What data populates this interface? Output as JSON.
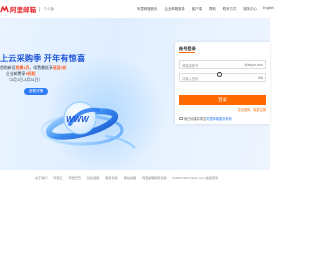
{
  "header": {
    "logo_text": "阿里邮箱",
    "logo_sub": "个人版",
    "nav": [
      {
        "label": "阿里邮箱首页"
      },
      {
        "label": "企业邮箱登录"
      },
      {
        "label": "客户端"
      },
      {
        "label": "帮助"
      },
      {
        "label": "联系方式"
      },
      {
        "label": "服务中心"
      },
      {
        "label": "English"
      }
    ]
  },
  "banner": {
    "title": "上云采购季 开年有惊喜",
    "line1_a": "首购新设",
    "line1_hl": "免费1月",
    "line1_b": "，续费最低享",
    "line1_hl2": "低至5折",
    "line2_a": "企业",
    "line2_b": "邮费享",
    "line2_hl": "9折起",
    "line3": "（3月1日-3月31日）",
    "button": "查看详情",
    "art_text": "WWW"
  },
  "login": {
    "title": "账号登录",
    "account_placeholder": "邮箱或账号",
    "account_suffix": "@aliyun.com",
    "password_placeholder": "请输入密码",
    "submit": "登录",
    "link_forgot": "忘记密码",
    "link_register": "免费注册",
    "agree_text": "我已阅读并同意",
    "agree_link": "阿里邮箱服务条款"
  },
  "footer": {
    "links": [
      "关于我们",
      "阿里云",
      "阿里巴巴",
      "隐私政策",
      "服务条款",
      "网站地图",
      "阿里邮箱服务条款",
      "©2009-2023 Aliyun.com 版权所有",
      "ICP证：浙B2-20080101"
    ]
  },
  "colors": {
    "brand": "#e5292e",
    "accent": "#ff6a00",
    "link": "#2f7df5",
    "banner_title": "#1d56d8"
  }
}
